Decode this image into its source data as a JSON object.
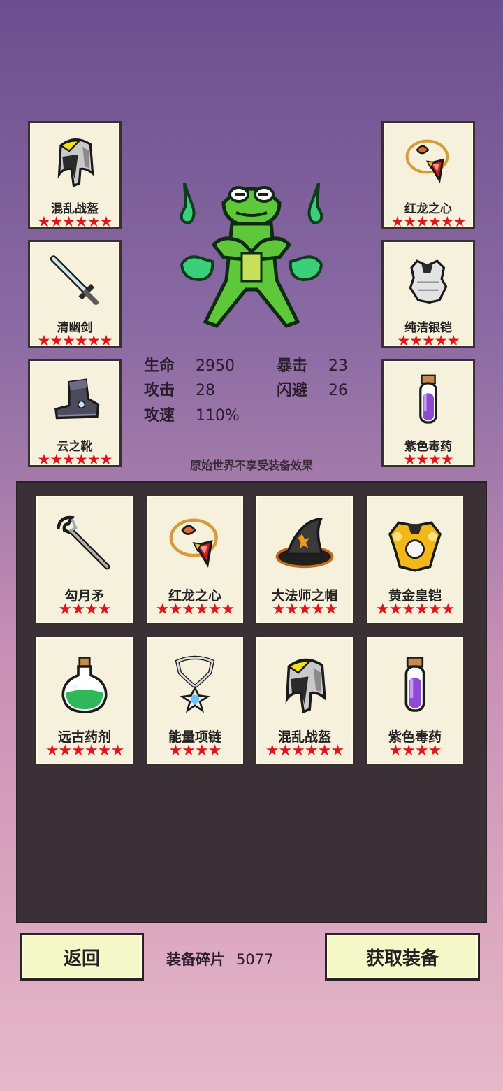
{
  "equipped_left": [
    {
      "name": "混乱战盔",
      "stars": "★★★★★★",
      "icon": "helmet-icon"
    },
    {
      "name": "清幽剑",
      "stars": "★★★★★★",
      "icon": "sword-icon"
    },
    {
      "name": "云之靴",
      "stars": "★★★★★★",
      "icon": "boot-icon"
    }
  ],
  "equipped_right": [
    {
      "name": "红龙之心",
      "stars": "★★★★★★",
      "icon": "amulet-icon"
    },
    {
      "name": "纯洁银铠",
      "stars": "★★★★★",
      "icon": "armor-icon"
    },
    {
      "name": "紫色毒药",
      "stars": "★★★★",
      "icon": "potion-vial-icon"
    }
  ],
  "stats": {
    "hp_label": "生命",
    "hp_value": "2950",
    "atk_label": "攻击",
    "atk_value": "28",
    "spd_label": "攻速",
    "spd_value": "110%",
    "crit_label": "暴击",
    "crit_value": "23",
    "dodge_label": "闪避",
    "dodge_value": "26"
  },
  "note": "原始世界不享受装备效果",
  "inventory": [
    {
      "name": "勾月矛",
      "stars": "★★★★",
      "icon": "spear-icon"
    },
    {
      "name": "红龙之心",
      "stars": "★★★★★★",
      "icon": "amulet-icon"
    },
    {
      "name": "大法师之帽",
      "stars": "★★★★★",
      "icon": "wizard-hat-icon"
    },
    {
      "name": "黄金皇铠",
      "stars": "★★★★★★",
      "icon": "gold-armor-icon"
    },
    {
      "name": "远古药剂",
      "stars": "★★★★★★",
      "icon": "green-flask-icon"
    },
    {
      "name": "能量项链",
      "stars": "★★★★",
      "icon": "necklace-icon"
    },
    {
      "name": "混乱战盔",
      "stars": "★★★★★★",
      "icon": "helmet-icon"
    },
    {
      "name": "紫色毒药",
      "stars": "★★★★",
      "icon": "potion-vial-icon"
    }
  ],
  "buttons": {
    "back": "返回",
    "get": "获取装备"
  },
  "fragments": {
    "label": "装备碎片",
    "value": "5077"
  },
  "colors": {
    "star": "#e1141c",
    "card": "#f6f1dc",
    "panel": "#3b3035",
    "button": "#f4f7c8"
  }
}
